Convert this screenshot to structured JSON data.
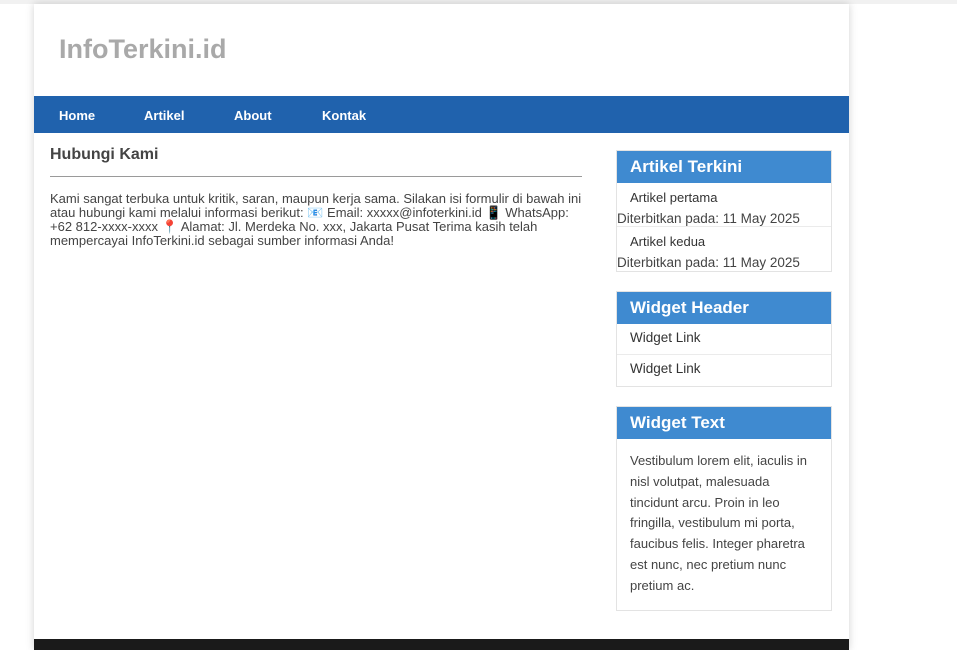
{
  "site": {
    "title": "InfoTerkini.id"
  },
  "nav": {
    "items": [
      "Home",
      "Artikel",
      "About",
      "Kontak"
    ]
  },
  "main": {
    "heading": "Hubungi Kami",
    "body": "Kami sangat terbuka untuk kritik, saran, maupun kerja sama. Silakan isi formulir di bawah ini atau hubungi kami melalui informasi berikut: 📧 Email: xxxxx@infoterkini.id 📱 WhatsApp: +62 812-xxxx-xxxx 📍 Alamat: Jl. Merdeka No. xxx, Jakarta Pusat Terima kasih telah mempercayai InfoTerkini.id sebagai sumber informasi Anda!"
  },
  "sidebar": {
    "recent": {
      "title": "Artikel Terkini",
      "items": [
        {
          "label": "Artikel pertama",
          "date": "Diterbitkan pada: 11 May 2025"
        },
        {
          "label": "Artikel kedua",
          "date": "Diterbitkan pada: 11 May 2025"
        }
      ]
    },
    "links_widget": {
      "title": "Widget Header",
      "items": [
        "Widget Link",
        "Widget Link"
      ]
    },
    "text_widget": {
      "title": "Widget Text",
      "body": "Vestibulum lorem elit, iaculis in nisl volutpat, malesuada tincidunt arcu. Proin in leo fringilla, vestibulum mi porta, faucibus felis. Integer pharetra est nunc, nec pretium nunc pretium ac."
    }
  },
  "colors": {
    "nav": "#2062ad",
    "widget_header": "#3f8ad0",
    "site_title": "#a9a9a9"
  }
}
